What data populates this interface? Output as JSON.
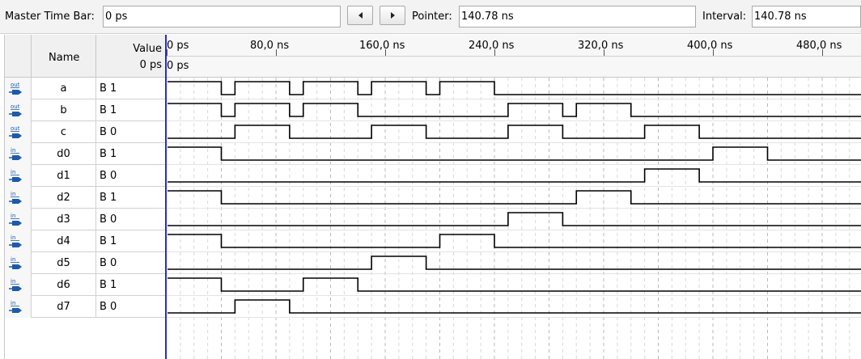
{
  "toolbar": {
    "master_label": "Master Time Bar:",
    "master_value": "0 ps",
    "pointer_label": "Pointer:",
    "pointer_value": "140.78 ns",
    "interval_label": "Interval:",
    "interval_value": "140.78 ns"
  },
  "columns": {
    "name": "Name",
    "value": "Value",
    "value_sub": "0 ps"
  },
  "ruler": {
    "ticks": [
      "0 ps",
      "80,0 ns",
      "160,0 ns",
      "240,0 ns",
      "320,0 ns",
      "400,0 ns",
      "480,0 ns"
    ],
    "cursor": "0 ps"
  },
  "signals": [
    {
      "type": "out",
      "name": "a",
      "value": "B 1",
      "toggles": [
        40,
        50,
        90,
        100,
        140,
        150,
        190,
        200,
        240
      ]
    },
    {
      "type": "out",
      "name": "b",
      "value": "B 1",
      "toggles": [
        40,
        50,
        90,
        100,
        140,
        250,
        290,
        300,
        340
      ]
    },
    {
      "type": "out",
      "name": "c",
      "value": "B 0",
      "toggles": [
        50,
        90,
        150,
        190,
        250,
        290,
        350,
        390
      ]
    },
    {
      "type": "in",
      "name": "d0",
      "value": "B 1",
      "toggles": [
        40,
        400,
        440
      ]
    },
    {
      "type": "in",
      "name": "d1",
      "value": "B 0",
      "toggles": [
        350,
        390
      ]
    },
    {
      "type": "in",
      "name": "d2",
      "value": "B 1",
      "toggles": [
        40,
        300,
        340
      ]
    },
    {
      "type": "in",
      "name": "d3",
      "value": "B 0",
      "toggles": [
        250,
        290
      ]
    },
    {
      "type": "in",
      "name": "d4",
      "value": "B 1",
      "toggles": [
        40,
        200,
        240
      ]
    },
    {
      "type": "in",
      "name": "d5",
      "value": "B 0",
      "toggles": [
        150,
        190
      ]
    },
    {
      "type": "in",
      "name": "d6",
      "value": "B 1",
      "toggles": [
        40,
        100,
        140
      ]
    },
    {
      "type": "in",
      "name": "d7",
      "value": "B 0",
      "toggles": [
        50,
        90
      ]
    }
  ],
  "colors": {
    "cursor": "#2a2ad0",
    "wave": "#000000",
    "grid_major": "#b8b8b8",
    "grid_minor": "#d8d8d8",
    "pin": "#1e5aa8"
  }
}
